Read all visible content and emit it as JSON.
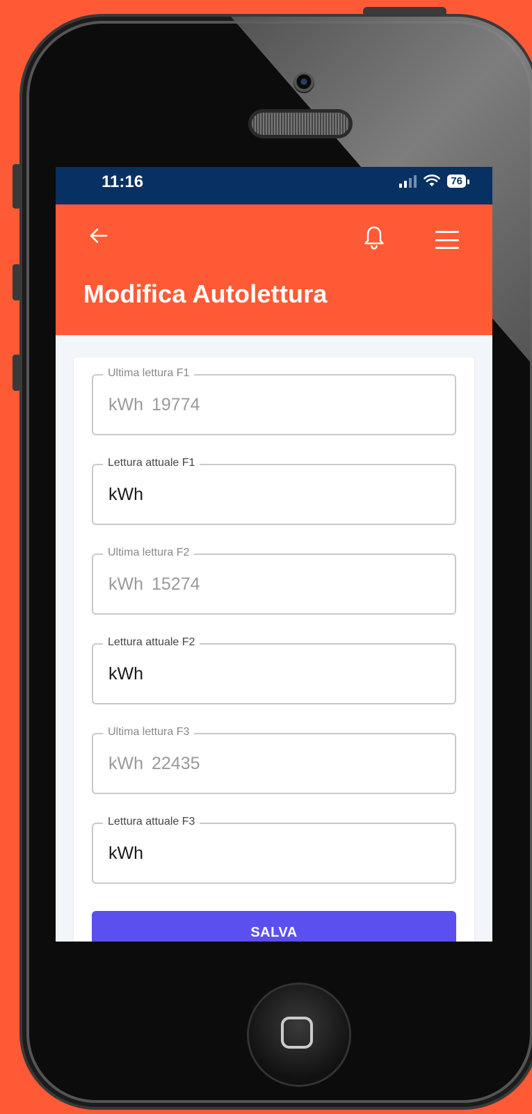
{
  "status_bar": {
    "time": "11:16",
    "battery": "76"
  },
  "header": {
    "title": "Modifica Autolettura"
  },
  "fields": [
    {
      "label": "Ultima lettura F1",
      "unit": "kWh",
      "value": "19774",
      "disabled": true
    },
    {
      "label": "Lettura attuale F1",
      "unit": "kWh",
      "value": "",
      "disabled": false
    },
    {
      "label": "Ultima lettura F2",
      "unit": "kWh",
      "value": "15274",
      "disabled": true
    },
    {
      "label": "Lettura attuale F2",
      "unit": "kWh",
      "value": "",
      "disabled": false
    },
    {
      "label": "Ultima lettura F3",
      "unit": "kWh",
      "value": "22435",
      "disabled": true
    },
    {
      "label": "Lettura attuale F3",
      "unit": "kWh",
      "value": "",
      "disabled": false
    }
  ],
  "actions": {
    "save_label": "SALVA"
  },
  "icons": {
    "back": "arrow-left-icon",
    "notifications": "bell-icon",
    "menu": "hamburger-menu-icon"
  },
  "colors": {
    "accent": "#ff5a36",
    "status_bar": "#073163",
    "button": "#5b4ff0"
  }
}
